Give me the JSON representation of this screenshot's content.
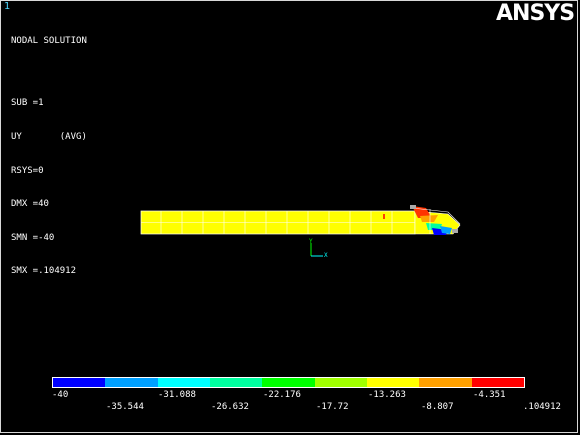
{
  "window_number": "1",
  "info": {
    "line1": "NODAL SOLUTION",
    "line2": "SUB =1",
    "line3": "UY       (AVG)",
    "line4": "RSYS=0",
    "line5": "DMX =40",
    "line6": "SMN =-40",
    "line7": "SMX =.104912"
  },
  "logo": "ANSYS",
  "triad": {
    "y": "Y",
    "x": "X"
  },
  "legend": {
    "colors": [
      "#0000ff",
      "#00a0ff",
      "#00ffff",
      "#00ffa0",
      "#00ff00",
      "#a0ff00",
      "#ffff00",
      "#ffa000",
      "#ff0000"
    ],
    "top_labels": [
      "-40",
      "-31.088",
      "-22.176",
      "-13.263",
      "-4.351"
    ],
    "bottom_labels": [
      "-35.544",
      "-26.632",
      "-17.72",
      "-8.807",
      ".104912"
    ]
  }
}
